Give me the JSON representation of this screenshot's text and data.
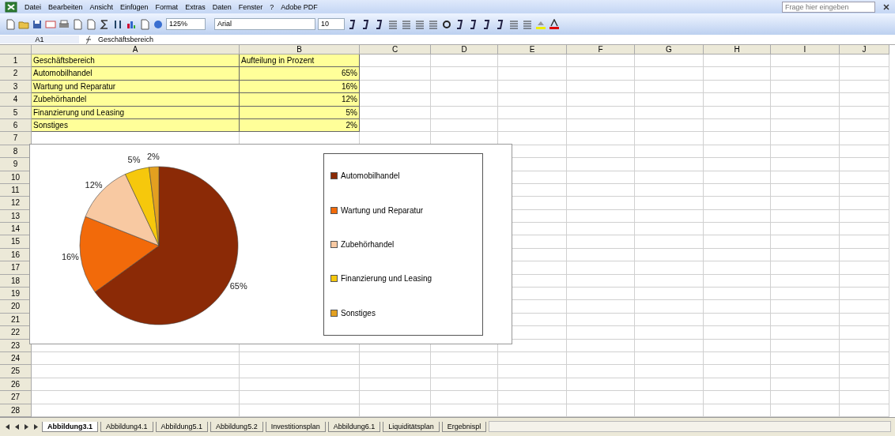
{
  "menu_bar": {
    "items": [
      "Datei",
      "Bearbeiten",
      "Ansicht",
      "Einfügen",
      "Format",
      "Extras",
      "Daten",
      "Fenster",
      "?",
      "Adobe PDF"
    ],
    "help_field": {
      "placeholder": "Frage hier eingeben"
    }
  },
  "toolbar": {
    "zoom": "125%",
    "font": "Arial",
    "font_size": "10"
  },
  "formula_bar": {
    "name_box": "A1",
    "formula": "Geschäftsbereich"
  },
  "columns": [
    "A",
    "B",
    "C",
    "D",
    "E",
    "F",
    "G",
    "H",
    "I",
    "J"
  ],
  "rows": [
    {
      "number": "1",
      "cells": [
        "Geschäftsbereich",
        "Aufteilung in Prozent"
      ]
    },
    {
      "number": "2",
      "cells": [
        "Automobilhandel",
        "65%"
      ]
    },
    {
      "number": "3",
      "cells": [
        "Wartung und Reparatur",
        "16%"
      ]
    },
    {
      "number": "4",
      "cells": [
        "Zubehörhandel",
        "12%"
      ]
    },
    {
      "number": "5",
      "cells": [
        "Finanzierung und Leasing",
        "5%"
      ]
    },
    {
      "number": "6",
      "cells": [
        "Sonstiges",
        "2%"
      ]
    },
    {
      "number": "7",
      "cells": []
    },
    {
      "number": "8",
      "cells": []
    },
    {
      "number": "9",
      "cells": []
    },
    {
      "number": "10",
      "cells": []
    },
    {
      "number": "11",
      "cells": []
    },
    {
      "number": "12",
      "cells": []
    },
    {
      "number": "13",
      "cells": []
    },
    {
      "number": "14",
      "cells": []
    },
    {
      "number": "15",
      "cells": []
    },
    {
      "number": "16",
      "cells": []
    },
    {
      "number": "17",
      "cells": []
    },
    {
      "number": "18",
      "cells": []
    },
    {
      "number": "19",
      "cells": []
    },
    {
      "number": "20",
      "cells": []
    },
    {
      "number": "21",
      "cells": []
    },
    {
      "number": "22",
      "cells": []
    },
    {
      "number": "23",
      "cells": []
    },
    {
      "number": "24",
      "cells": []
    },
    {
      "number": "25",
      "cells": []
    },
    {
      "number": "26",
      "cells": []
    },
    {
      "number": "27",
      "cells": []
    },
    {
      "number": "28",
      "cells": []
    }
  ],
  "chart": {
    "chart_data": {
      "type": "pie",
      "categories": [
        "Automobilhandel",
        "Wartung und Reparatur",
        "Zubehörhandel",
        "Finanzierung und Leasing",
        "Sonstiges"
      ],
      "series": [
        {
          "values": [
            65,
            16,
            12,
            5,
            2
          ]
        }
      ],
      "legend": "right",
      "colors": [
        "#8b2a06",
        "#f26a0a",
        "#f8c9a2",
        "#f6c80c",
        "#e3a020"
      ],
      "value_labels": [
        "65%",
        "16%",
        "12%",
        "5%",
        "2%"
      ]
    }
  },
  "sheet_tabs": [
    {
      "label": "Abbildung3.1",
      "selected": true
    },
    {
      "label": "Abbildung4.1",
      "selected": false
    },
    {
      "label": "Abbildung5.1",
      "selected": false
    },
    {
      "label": "Abbildung5.2",
      "selected": false
    },
    {
      "label": "Investitionsplan",
      "selected": false
    },
    {
      "label": "Abbildung6.1",
      "selected": false
    },
    {
      "label": "Liquiditätsplan",
      "selected": false
    },
    {
      "label": "Ergebnispl",
      "selected": false
    }
  ]
}
